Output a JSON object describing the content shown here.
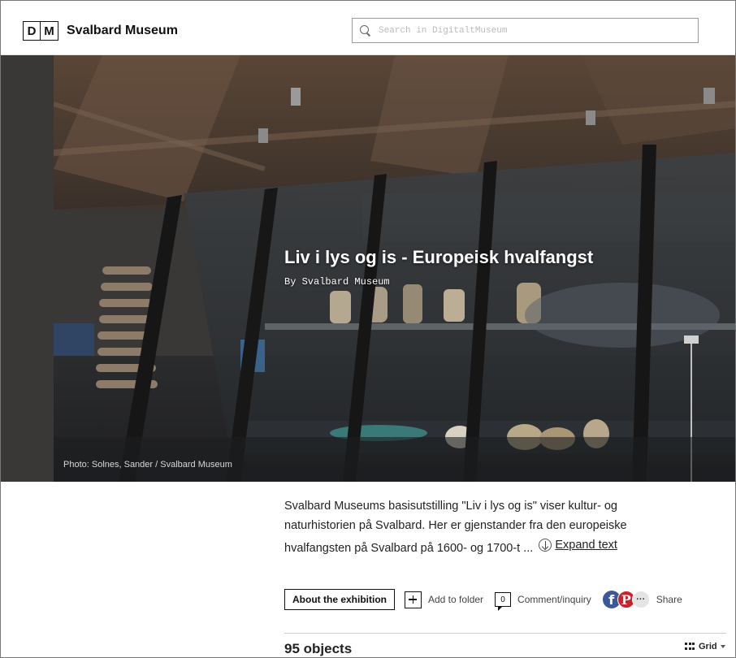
{
  "header": {
    "logo_letters": [
      "D",
      "M"
    ],
    "brand": "Svalbard Museum",
    "search_placeholder": "Search in DigitaltMuseum"
  },
  "hero": {
    "title": "Liv i lys og is - Europeisk hvalfangst",
    "byline": "By Svalbard Museum",
    "credit": "Photo: Solnes, Sander / Svalbard Museum"
  },
  "description": {
    "text": "Svalbard Museums basisutstilling \"Liv i lys og is\" viser kultur- og naturhistorien på Svalbard. Her er gjenstander fra den europeiske hvalfangsten på Svalbard på 1600- og 1700-t ...",
    "expand_label": "Expand text"
  },
  "actions": {
    "about_label": "About the exhibition",
    "add_folder_label": "Add to folder",
    "comment_count": "0",
    "comment_label": "Comment/inquiry",
    "share_label": "Share"
  },
  "results": {
    "count_label": "95 objects",
    "view_label": "Grid"
  },
  "colors": {
    "facebook": "#3b5998",
    "pinterest": "#c8232c"
  }
}
